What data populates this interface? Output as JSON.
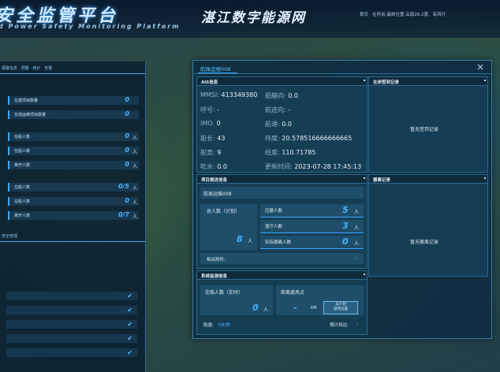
{
  "header": {
    "platform_title": "安全监管平台",
    "platform_subtitle": "d Power Safety Monitoring Platform",
    "center_title": "湛江数字能源网",
    "top_right_info": "首页  · 在所有  最新位置      云南26.2度、有风行"
  },
  "left_panel": {
    "tabs": "报警信息  · 预警  · 统计  · 告警",
    "rows": [
      {
        "label": "在建项目数量",
        "value": "0",
        "unit": ""
      },
      {
        "label": "在线运维项目数量",
        "value": "0",
        "unit": ""
      },
      {
        "label": "在船人数",
        "value": "0",
        "unit": "人"
      },
      {
        "label": "在船人数",
        "value": "0",
        "unit": "人"
      },
      {
        "label": "离开人数",
        "value": "0",
        "unit": "人"
      },
      {
        "label": "在船人数",
        "value": "0/5",
        "unit": "人"
      },
      {
        "label": "在船人数",
        "value": "0",
        "unit": "人"
      },
      {
        "label": "离开人数",
        "value": "0/7",
        "unit": "人"
      }
    ],
    "section_label": "安全管理"
  },
  "dialog": {
    "tab_label": "航珠运维008",
    "close_label": "×",
    "ais": {
      "title": "AIS信息",
      "fields": [
        {
          "label": "MMSI:",
          "value": "413349380"
        },
        {
          "label": "船艏向:",
          "value": "0.0"
        },
        {
          "label": "呼号:",
          "value": "-"
        },
        {
          "label": "航迹向:",
          "value": "-"
        },
        {
          "label": "IMO:",
          "value": "0"
        },
        {
          "label": "航速:",
          "value": "0.0"
        },
        {
          "label": "船长:",
          "value": "43"
        },
        {
          "label": "纬度:",
          "value": "20.578516666666665"
        },
        {
          "label": "船宽:",
          "value": "9"
        },
        {
          "label": "经度:",
          "value": "110.71785"
        },
        {
          "label": "吃水:",
          "value": "0.0"
        },
        {
          "label": "更新时间:",
          "value": "2023-07-28 17:45:13"
        }
      ]
    },
    "checkin": {
      "title": "在岸签到记录",
      "empty_text": "暂无签到记录"
    },
    "project": {
      "title": "项目报送信息",
      "ship_name": "航珠运维008",
      "total_label": "总人数（计划）",
      "total_value": "8",
      "total_unit": "人",
      "should_label": "应撤人数",
      "should_value": "5",
      "should_unit": "人",
      "stay_label": "值守人数",
      "stay_value": "3",
      "stay_unit": "人",
      "actual_label": "实际撤离人数",
      "actual_value": "0",
      "actual_unit": "人",
      "attachment_label": "相关附件:",
      "attachment_value": "-"
    },
    "evacuation": {
      "title": "撤离记录",
      "empty_text": "暂无撤离记录"
    },
    "monitor": {
      "title": "系统监测信息",
      "onboard_label": "在船人数（实时）",
      "onboard_value": "0",
      "onboard_unit": "人",
      "distance_label": "距离避风点",
      "distance_value": "-",
      "distance_unit": "KM",
      "route_button": "未计划\n避风位置",
      "speed_label": "航速:",
      "speed_value": "0米/秒",
      "eta_label": "预计到达:",
      "eta_value": "-"
    }
  }
}
